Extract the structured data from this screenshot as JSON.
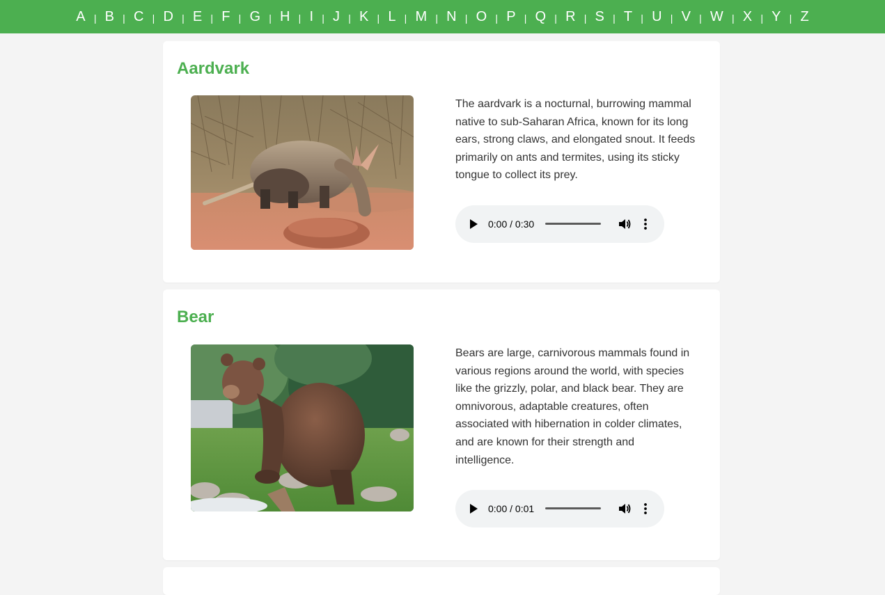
{
  "nav": {
    "letters": [
      "A",
      "B",
      "C",
      "D",
      "E",
      "F",
      "G",
      "H",
      "I",
      "J",
      "K",
      "L",
      "M",
      "N",
      "O",
      "P",
      "Q",
      "R",
      "S",
      "T",
      "U",
      "V",
      "W",
      "X",
      "Y",
      "Z"
    ],
    "separator": "|"
  },
  "animals": [
    {
      "name": "Aardvark",
      "description": "The aardvark is a nocturnal, burrowing mammal native to sub-Saharan Africa, known for its long ears, strong claws, and elongated snout. It feeds primarily on ants and termites, using its sticky tongue to collect its prey.",
      "audio_time": "0:00 / 0:30"
    },
    {
      "name": "Bear",
      "description": "Bears are large, carnivorous mammals found in various regions around the world, with species like the grizzly, polar, and black bear. They are omnivorous, adaptable creatures, often associated with hibernation in colder climates, and are known for their strength and intelligence.",
      "audio_time": "0:00 / 0:01"
    }
  ],
  "colors": {
    "accent": "#4caf50",
    "page_bg": "#f4f4f4",
    "card_bg": "#ffffff",
    "text": "#333333",
    "player_bg": "#f1f3f4"
  },
  "icons": {
    "play": "play-icon",
    "volume": "volume-icon",
    "more": "more-options-icon"
  }
}
